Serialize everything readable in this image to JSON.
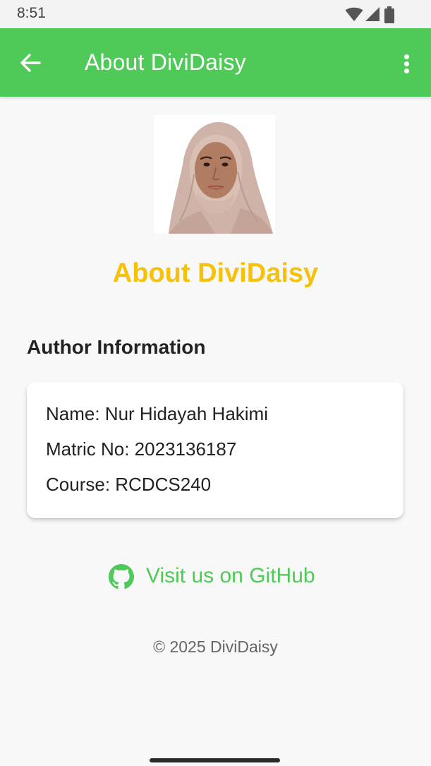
{
  "status_bar": {
    "time": "8:51",
    "icons": [
      "wifi-icon",
      "cell-signal-icon",
      "battery-icon"
    ]
  },
  "app_bar": {
    "title": "About DiviDaisy",
    "back_icon": "arrow-left-icon",
    "menu_icon": "more-vert-icon",
    "color": "#4fc957"
  },
  "main": {
    "photo_subject": "author-photo",
    "heading": "About DiviDaisy",
    "heading_color": "#f5c10b",
    "section_title": "Author Information",
    "author": {
      "name": "Name: Nur Hidayah Hakimi",
      "matric": "Matric No: 2023136187",
      "course": "Course: RCDCS240"
    },
    "github": {
      "icon": "github-icon",
      "label": "Visit us on GitHub"
    },
    "copyright": "© 2025 DiviDaisy"
  }
}
